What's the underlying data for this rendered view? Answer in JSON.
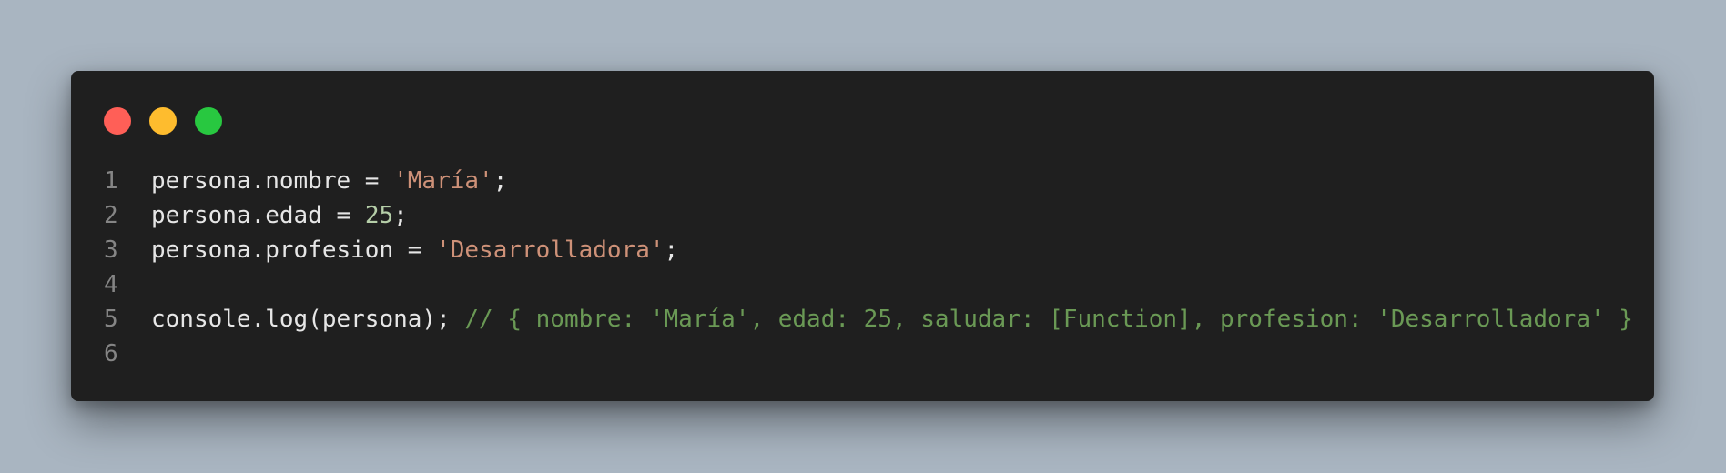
{
  "window": {
    "controls": {
      "close_color": "#ff5f57",
      "minimize_color": "#febc2e",
      "maximize_color": "#28c840"
    }
  },
  "editor": {
    "colors": {
      "background": "#1f1f1f",
      "text": "#e6e6e6",
      "string": "#ce9178",
      "number": "#b5cea8",
      "comment": "#6a9955",
      "line_number": "#858585"
    },
    "lines": [
      {
        "number": "1",
        "tokens": [
          {
            "type": "plain",
            "text": "persona.nombre = "
          },
          {
            "type": "string",
            "text": "'María'"
          },
          {
            "type": "plain",
            "text": ";"
          }
        ]
      },
      {
        "number": "2",
        "tokens": [
          {
            "type": "plain",
            "text": "persona.edad = "
          },
          {
            "type": "number",
            "text": "25"
          },
          {
            "type": "plain",
            "text": ";"
          }
        ]
      },
      {
        "number": "3",
        "tokens": [
          {
            "type": "plain",
            "text": "persona.profesion = "
          },
          {
            "type": "string",
            "text": "'Desarrolladora'"
          },
          {
            "type": "plain",
            "text": ";"
          }
        ]
      },
      {
        "number": "4",
        "tokens": []
      },
      {
        "number": "5",
        "tokens": [
          {
            "type": "plain",
            "text": "console.log(persona); "
          },
          {
            "type": "comment",
            "text": "// { nombre: 'María', edad: 25, saludar: [Function], profesion: 'Desarrolladora' }"
          }
        ]
      },
      {
        "number": "6",
        "tokens": []
      }
    ]
  }
}
